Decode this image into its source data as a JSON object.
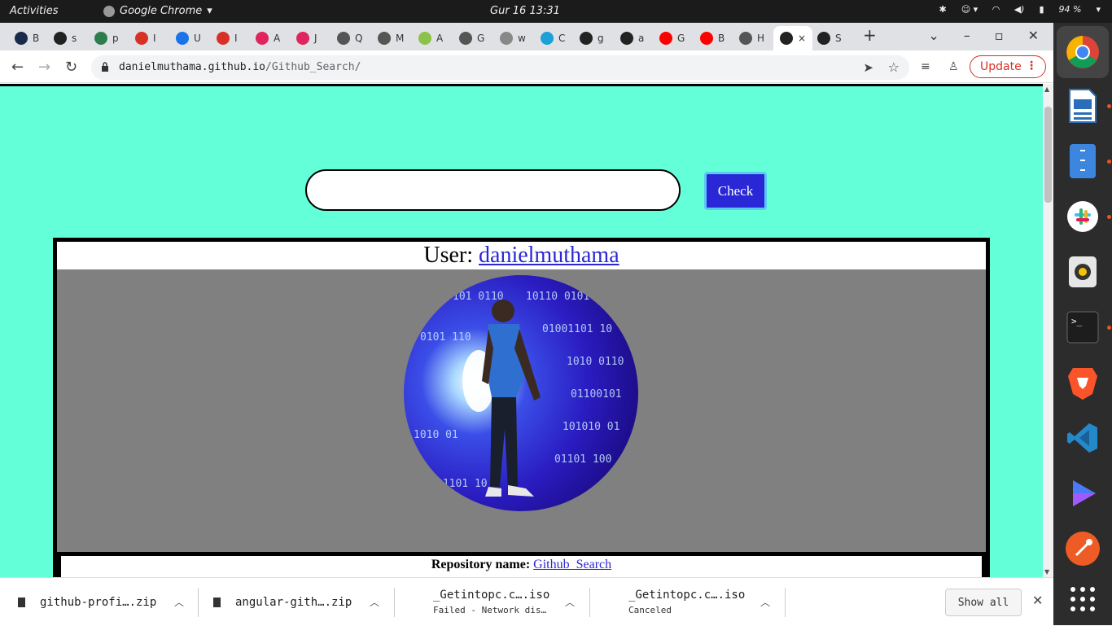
{
  "system": {
    "activities": "Activities",
    "app_name": "Google Chrome",
    "clock": "Gur 16  13:31",
    "battery": "94 %"
  },
  "tabs": [
    {
      "label": "B",
      "color": "#1a2b4a"
    },
    {
      "label": "s",
      "color": "#222222"
    },
    {
      "label": "p",
      "color": "#2e7d4f"
    },
    {
      "label": "I",
      "color": "#d93025"
    },
    {
      "label": "U",
      "color": "#1a73e8"
    },
    {
      "label": "I",
      "color": "#d93025"
    },
    {
      "label": "A",
      "color": "#e0245e"
    },
    {
      "label": "J",
      "color": "#e0245e"
    },
    {
      "label": "Q",
      "color": "#555555"
    },
    {
      "label": "M",
      "color": "#555555"
    },
    {
      "label": "A",
      "color": "#8bc34a"
    },
    {
      "label": "G",
      "color": "#555555"
    },
    {
      "label": "w",
      "color": "#888888"
    },
    {
      "label": "C",
      "color": "#1ba0d7"
    },
    {
      "label": "g",
      "color": "#222222"
    },
    {
      "label": "a",
      "color": "#222222"
    },
    {
      "label": "G",
      "color": "#ff0000"
    },
    {
      "label": "B",
      "color": "#ff0000"
    },
    {
      "label": "H",
      "color": "#555555"
    },
    {
      "label": "×",
      "color": "#222222"
    },
    {
      "label": "S",
      "color": "#222222"
    }
  ],
  "toolbar": {
    "url_host": "danielmuthama.github.io",
    "url_path": "/Github_Search/",
    "update_label": "Update"
  },
  "page": {
    "search_value": "",
    "check_label": "Check",
    "user_prefix": "User:",
    "username": "danielmuthama",
    "repo_prefix": "Repository name:",
    "repo_name": "Github_Search"
  },
  "downloads": [
    {
      "name": "github-profi….zip",
      "status": ""
    },
    {
      "name": "angular-gith….zip",
      "status": ""
    },
    {
      "name": "_Getintopc.c….iso",
      "status": "Failed - Network dis…"
    },
    {
      "name": "_Getintopc.c….iso",
      "status": "Canceled"
    }
  ],
  "shelf": {
    "show_all": "Show all"
  },
  "colors": {
    "page_bg": "#63ffd9",
    "accent": "#2a27d6",
    "avatar_bg": "#808080"
  }
}
